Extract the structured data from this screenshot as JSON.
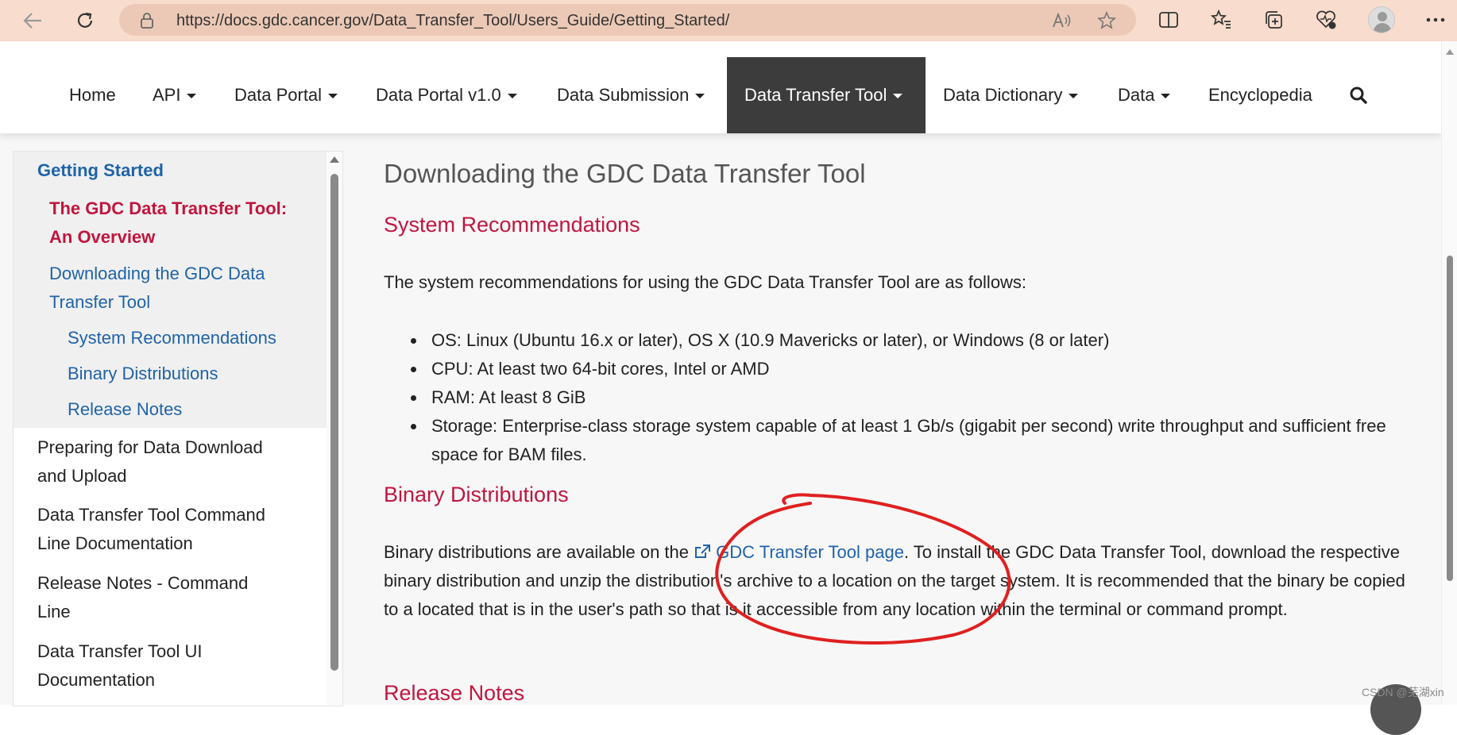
{
  "browser": {
    "url": "https://docs.gdc.cancer.gov/Data_Transfer_Tool/Users_Guide/Getting_Started/",
    "icons": [
      "back-icon",
      "refresh-icon",
      "lock-icon",
      "read-aloud-icon",
      "favorite-star-icon",
      "split-screen-icon",
      "favorites-icon",
      "collections-icon",
      "browser-essentials-icon",
      "profile-avatar",
      "more-icon"
    ]
  },
  "nav": {
    "items": [
      {
        "label": "Home",
        "dropdown": false
      },
      {
        "label": "API",
        "dropdown": true
      },
      {
        "label": "Data Portal",
        "dropdown": true
      },
      {
        "label": "Data Portal v1.0",
        "dropdown": true
      },
      {
        "label": "Data Submission",
        "dropdown": true
      },
      {
        "label": "Data Transfer Tool",
        "dropdown": true,
        "active": true
      },
      {
        "label": "Data Dictionary",
        "dropdown": true
      },
      {
        "label": "Data",
        "dropdown": true
      },
      {
        "label": "Encyclopedia",
        "dropdown": false
      }
    ],
    "active_color": "#3c3c3c"
  },
  "sidebar": {
    "heading": "Getting Started",
    "current_line1": "The GDC Data Transfer Tool:",
    "current_line2": "An Overview",
    "download_line1": "Downloading the GDC Data",
    "download_line2": "Transfer Tool",
    "sub_items": [
      "System Recommendations",
      "Binary Distributions",
      "Release Notes"
    ],
    "preparing_line1": "Preparing for Data Download",
    "preparing_line2": "and Upload",
    "cmd_doc_line1": "Data Transfer Tool Command",
    "cmd_doc_line2": "Line Documentation",
    "release_cmd_line1": "Release Notes - Command",
    "release_cmd_line2": "Line",
    "ui_doc_line1": "Data Transfer Tool UI",
    "ui_doc_line2": "Documentation"
  },
  "content": {
    "title": "Downloading the GDC Data Transfer Tool",
    "sys_rec_heading": "System Recommendations",
    "sys_rec_intro": "The system recommendations for using the GDC Data Transfer Tool are as follows:",
    "bullets": [
      "OS: Linux (Ubuntu 16.x or later), OS X (10.9 Mavericks or later), or Windows (8 or later)",
      "CPU: At least two 64-bit cores, Intel or AMD",
      "RAM: At least 8 GiB",
      "Storage: Enterprise-class storage system capable of at least 1 Gb/s (gigabit per second) write throughput and sufficient free space for BAM files."
    ],
    "binary_heading": "Binary Distributions",
    "binary_before": "Binary distributions are available on the ",
    "binary_link": "GDC Transfer Tool page",
    "binary_after": ". To install the GDC Data Transfer Tool, download the respective binary distribution and unzip the distribution's archive to a location on the target system. It is recommended that the binary be copied to a located that is in the user's path so that is it accessible from any location within the terminal or command prompt.",
    "release_heading": "Release Notes"
  },
  "colors": {
    "heading_red": "#c0163f",
    "link_blue": "#1f63a8",
    "annotation_red": "#e02020",
    "browser_bar": "#f8dccd"
  },
  "watermark": "CSDN @芜湖xin"
}
